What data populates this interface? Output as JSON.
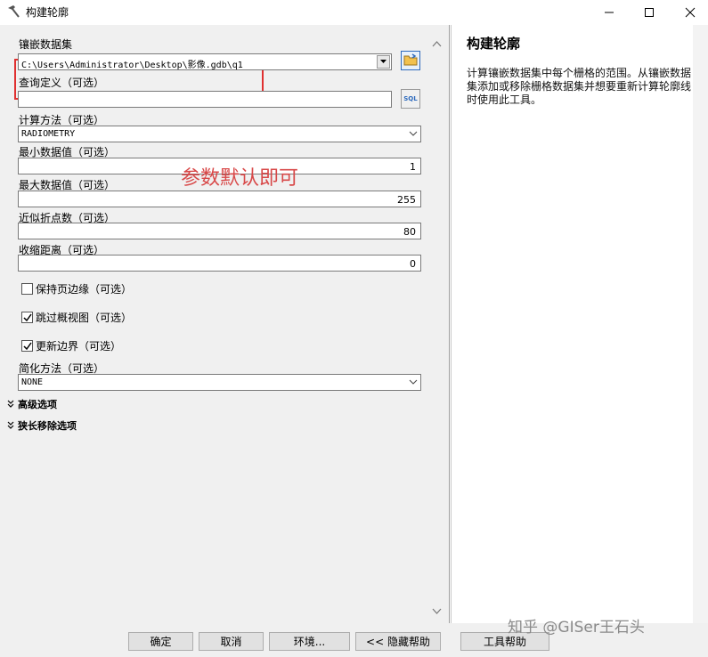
{
  "window": {
    "title": "构建轮廓",
    "app_icon": "hammer-icon",
    "controls": [
      "minimize-icon",
      "maximize-icon",
      "close-icon"
    ]
  },
  "form": {
    "dataset": {
      "label": "镶嵌数据集",
      "value": "C:\\Users\\Administrator\\Desktop\\影像.gdb\\q1"
    },
    "query": {
      "label": "查询定义（可选）",
      "value": "",
      "sql_button": "SQL"
    },
    "method": {
      "label": "计算方法（可选）",
      "value": "RADIOMETRY"
    },
    "min_value": {
      "label": "最小数据值（可选）",
      "value": "1"
    },
    "max_value": {
      "label": "最大数据值（可选）",
      "value": "255"
    },
    "vertices": {
      "label": "近似折点数（可选）",
      "value": "80"
    },
    "shrink": {
      "label": "收缩距离（可选）",
      "value": "0"
    },
    "keep_edge": {
      "label": "保持页边缘（可选）",
      "checked": false
    },
    "skip_overviews": {
      "label": "跳过概视图（可选）",
      "checked": true
    },
    "update_boundary": {
      "label": "更新边界（可选）",
      "checked": true
    },
    "simplify": {
      "label": "简化方法（可选）",
      "value": "NONE"
    },
    "advanced": {
      "label": "高级选项"
    },
    "sliver": {
      "label": "狭长移除选项"
    }
  },
  "annotation": {
    "text": "参数默认即可",
    "color": "#d84848"
  },
  "help": {
    "title": "构建轮廓",
    "text": "计算镶嵌数据集中每个栅格的范围。从镶嵌数据集添加或移除栅格数据集并想要重新计算轮廓线时使用此工具。"
  },
  "buttons": {
    "ok": "确定",
    "cancel": "取消",
    "env": "环境...",
    "hide_help": "<< 隐藏帮助",
    "tool_help": "工具帮助"
  },
  "watermark": "知乎 @GISer王石头"
}
